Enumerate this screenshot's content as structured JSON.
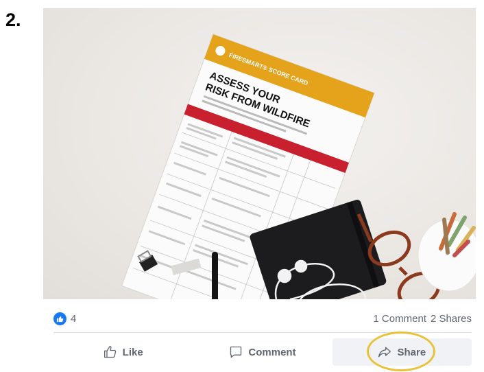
{
  "step": {
    "number": "2."
  },
  "photo": {
    "card": {
      "brand": "FIRESMART® SCORE CARD",
      "title_line1": "ASSESS YOUR",
      "title_line2": "RISK FROM WILDFIRE"
    },
    "colors": {
      "card_header": "#e5a21b",
      "card_band": "#c8202f",
      "notebook": "#1c1c1f",
      "glasses": "#8b3a1e"
    }
  },
  "post": {
    "reactions": {
      "icon": "like-reaction-icon",
      "count": "4"
    },
    "stats": {
      "comments": "1 Comment",
      "shares": "2 Shares"
    },
    "actions": {
      "like": "Like",
      "comment": "Comment",
      "share": "Share"
    },
    "colors": {
      "facebook_blue": "#1877f2",
      "muted_text": "#606770",
      "highlight": "#e8c33a"
    }
  }
}
